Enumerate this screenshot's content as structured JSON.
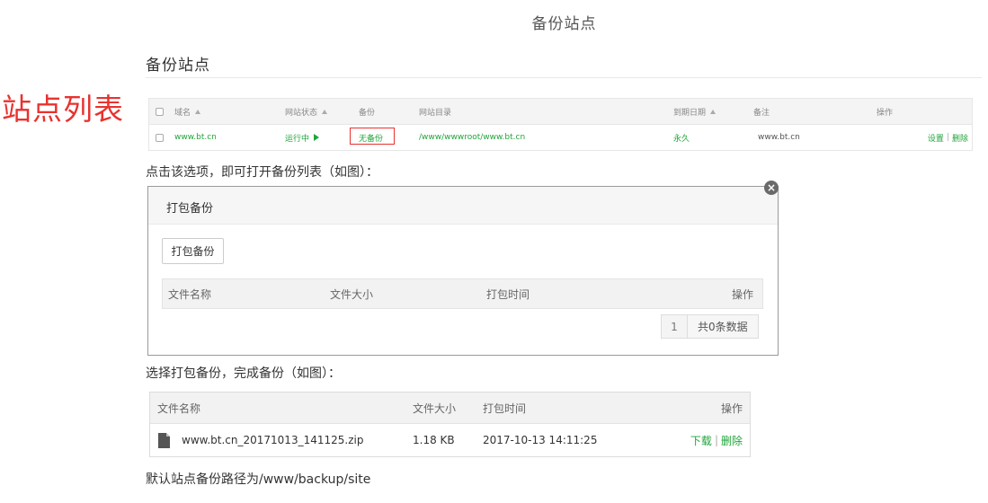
{
  "page_title": "备份站点",
  "section_title": "备份站点",
  "caption": "站点列表",
  "site_list": {
    "headers": {
      "domain": "域名",
      "status": "网站状态",
      "backup": "备份",
      "root": "网站目录",
      "expire": "到期日期",
      "note": "备注",
      "ops": "操作"
    },
    "row": {
      "domain": "www.bt.cn",
      "status": "运行中",
      "backup": "无备份",
      "root": "/www/wwwroot/www.bt.cn",
      "expire": "永久",
      "note": "www.bt.cn",
      "op_settings": "设置",
      "op_sep": "|",
      "op_delete": "删除"
    }
  },
  "instruction1": "点击该选项，即可打开备份列表（如图）：",
  "dialog": {
    "title": "打包备份",
    "close": "×",
    "pack_button": "打包备份",
    "headers": {
      "name": "文件名称",
      "size": "文件大小",
      "time": "打包时间",
      "ops": "操作"
    },
    "pager_page": "1",
    "pager_total": "共0条数据"
  },
  "instruction2": "选择打包备份，完成备份（如图）：",
  "result": {
    "headers": {
      "name": "文件名称",
      "size": "文件大小",
      "time": "打包时间",
      "ops": "操作"
    },
    "row": {
      "name": "www.bt.cn_20171013_141125.zip",
      "size": "1.18 KB",
      "time": "2017-10-13 14:11:25",
      "download": "下载",
      "sep": "|",
      "delete": "删除"
    }
  },
  "footer_text": "默认站点备份路径为/www/backup/site",
  "colors": {
    "accent_green": "#20a53a",
    "highlight_red": "#e8322f"
  },
  "icons": [
    "sort-up-icon",
    "play-icon",
    "close-icon",
    "file-icon"
  ]
}
